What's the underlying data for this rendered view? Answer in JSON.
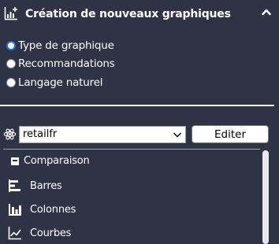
{
  "header": {
    "title": "Création de nouveaux graphiques",
    "icon": "chart-plus-icon",
    "collapse_icon": "chevron-up-icon"
  },
  "modes": {
    "selected": "Type de graphique",
    "options": [
      "Type de graphique",
      "Recommandations",
      "Langage naturel"
    ]
  },
  "datasource": {
    "icon": "atom-icon",
    "selected": "retailfr",
    "edit_label": "Editer"
  },
  "chart_types": {
    "section": {
      "label": "Comparaison",
      "icon": "collapse-square-icon"
    },
    "items": [
      {
        "label": "Barres",
        "icon": "horizontal-bar-chart-icon"
      },
      {
        "label": "Colonnes",
        "icon": "column-chart-icon"
      },
      {
        "label": "Courbes",
        "icon": "line-chart-icon"
      }
    ]
  },
  "colors": {
    "background": "#2e3445",
    "text": "#ffffff",
    "radio_accent": "#1a73e8"
  }
}
